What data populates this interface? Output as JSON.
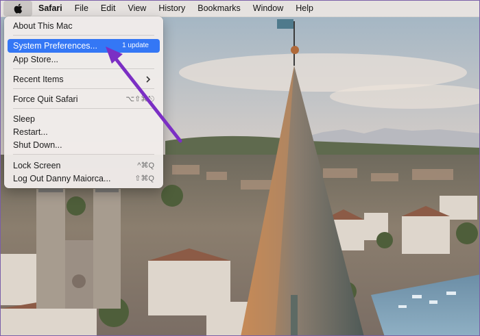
{
  "menubar": {
    "apple_icon": "apple-logo-icon",
    "app_name": "Safari",
    "items": [
      "File",
      "Edit",
      "View",
      "History",
      "Bookmarks",
      "Window",
      "Help"
    ]
  },
  "apple_menu": {
    "about": "About This Mac",
    "system_preferences": "System Preferences...",
    "system_preferences_badge": "1 update",
    "app_store": "App Store...",
    "recent_items": "Recent Items",
    "force_quit": "Force Quit Safari",
    "force_quit_shortcut": "⌥⇧⌘⎋",
    "sleep": "Sleep",
    "restart": "Restart...",
    "shut_down": "Shut Down...",
    "lock_screen": "Lock Screen",
    "lock_screen_shortcut": "^⌘Q",
    "log_out": "Log Out Danny Maiorca...",
    "log_out_shortcut": "⇧⌘Q"
  },
  "annotation": {
    "arrow_color": "#7b2fc4"
  },
  "colors": {
    "selection": "#3477f5",
    "sky": "#c9d6df",
    "roof": "#9a6b4e"
  }
}
